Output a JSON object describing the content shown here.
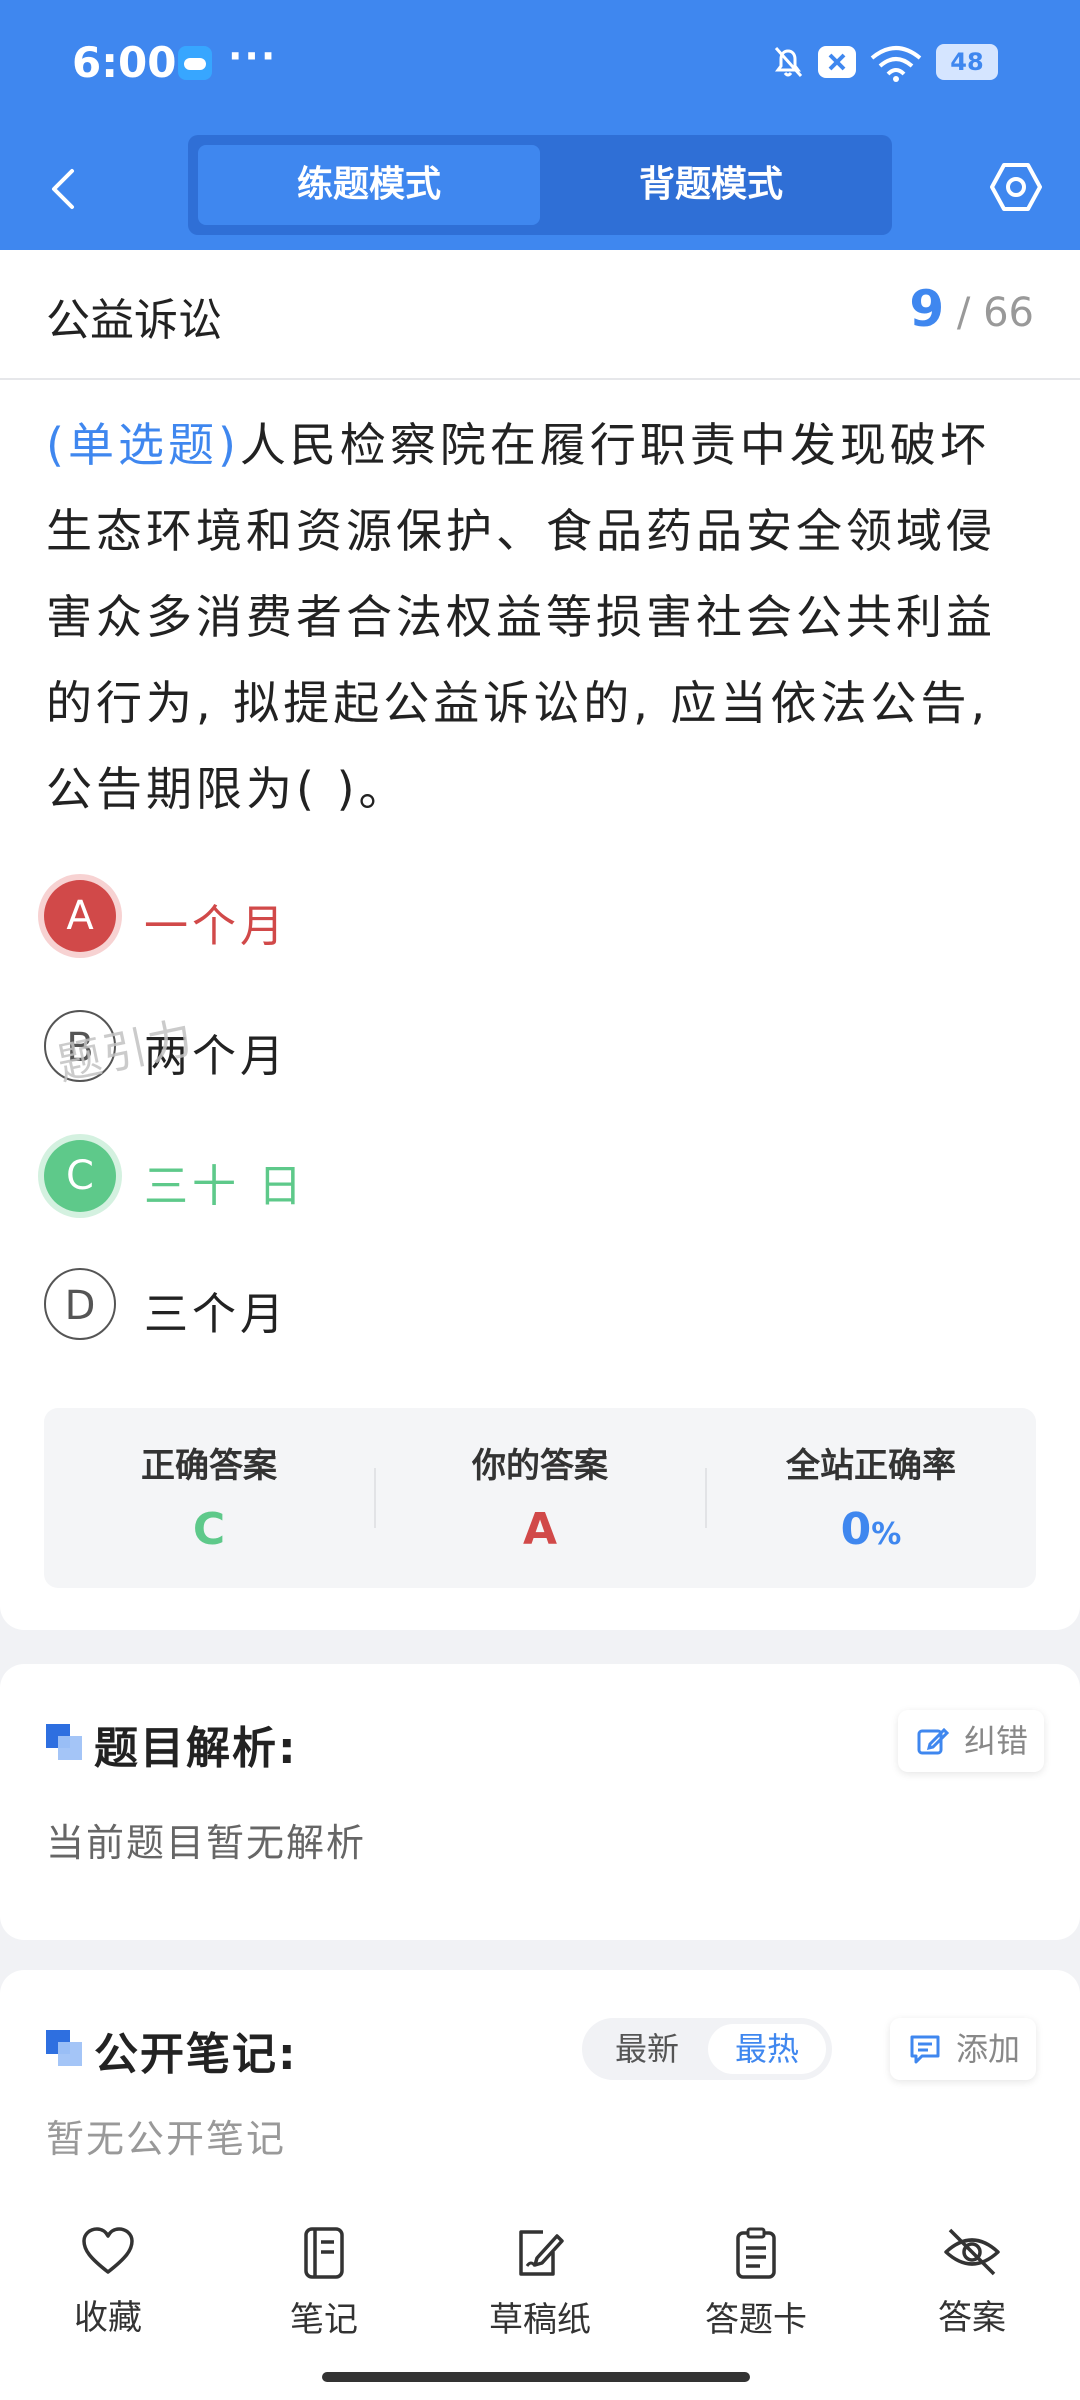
{
  "status_bar": {
    "time": "6:00",
    "dots": "···",
    "battery": "48"
  },
  "nav": {
    "tab_practice": "练题模式",
    "tab_memorize": "背题模式"
  },
  "section": {
    "title": "公益诉讼",
    "current": "9",
    "total": "/ 66"
  },
  "question": {
    "type": "(单选题)",
    "text": "人民检察院在履行职责中发现破坏生态环境和资源保护、食品药品安全领域侵害众多消费者合法权益等损害社会公共利益的行为, 拟提起公益诉讼的, 应当依法公告,公告期限为(        )。"
  },
  "options": [
    {
      "letter": "A",
      "text": "一个月"
    },
    {
      "letter": "B",
      "text": "两个月"
    },
    {
      "letter": "C",
      "text": "三十 日"
    },
    {
      "letter": "D",
      "text": "三个月"
    }
  ],
  "watermark": "题引力",
  "answer": {
    "correct_label": "正确答案",
    "correct_value": "C",
    "yours_label": "你的答案",
    "yours_value": "A",
    "rate_label": "全站正确率",
    "rate_value": "0",
    "rate_unit": "%"
  },
  "analysis": {
    "title": "题目解析:",
    "correct_btn": "纠错",
    "content": "当前题目暂无解析"
  },
  "notes": {
    "title": "公开笔记:",
    "sort_new": "最新",
    "sort_hot": "最热",
    "add_btn": "添加",
    "content": "暂无公开笔记"
  },
  "tabbar": [
    {
      "label": "收藏"
    },
    {
      "label": "笔记"
    },
    {
      "label": "草稿纸"
    },
    {
      "label": "答题卡"
    },
    {
      "label": "答案"
    }
  ],
  "colors": {
    "primary": "#3f87ef",
    "wrong": "#d14949",
    "right": "#5ec98a"
  }
}
